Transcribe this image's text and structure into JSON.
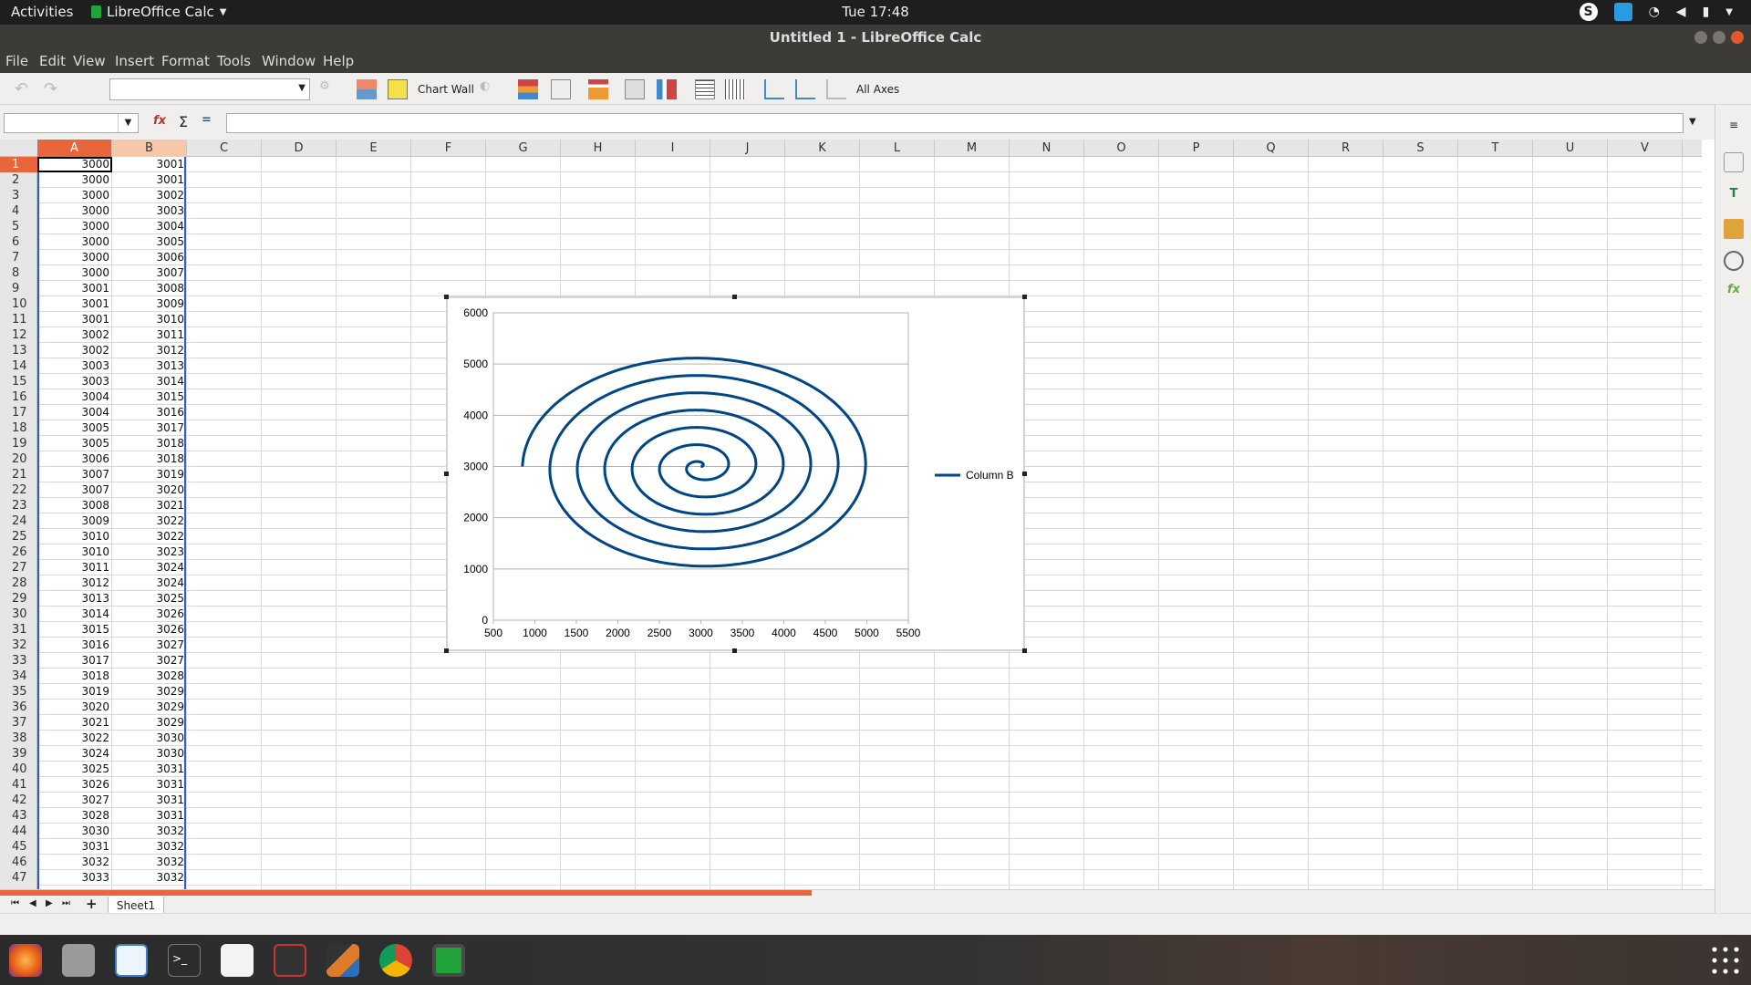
{
  "topbar": {
    "activities": "Activities",
    "app_name": "LibreOffice Calc",
    "clock": "Tue 17:48",
    "skype": "S"
  },
  "window": {
    "title": "Untitled 1 - LibreOffice Calc"
  },
  "menu": [
    "File",
    "Edit",
    "View",
    "Insert",
    "Format",
    "Tools",
    "Window",
    "Help"
  ],
  "toolbar": {
    "chart_wall": "Chart Wall",
    "all_axes": "All Axes"
  },
  "columns": [
    "A",
    "B",
    "C",
    "D",
    "E",
    "F",
    "G",
    "H",
    "I",
    "J",
    "K",
    "L",
    "M",
    "N",
    "O",
    "P",
    "Q",
    "R",
    "S",
    "T",
    "U",
    "V"
  ],
  "rows": [
    1,
    2,
    3,
    4,
    5,
    6,
    7,
    8,
    9,
    10,
    11,
    12,
    13,
    14,
    15,
    16,
    17,
    18,
    19,
    20,
    21,
    22,
    23,
    24,
    25,
    26,
    27,
    28,
    29,
    30,
    31,
    32,
    33,
    34,
    35,
    36,
    37,
    38,
    39,
    40,
    41,
    42,
    43,
    44,
    45,
    46,
    47
  ],
  "cells": {
    "A": [
      3000,
      3000,
      3000,
      3000,
      3000,
      3000,
      3000,
      3000,
      3001,
      3001,
      3001,
      3002,
      3002,
      3003,
      3003,
      3004,
      3004,
      3005,
      3005,
      3006,
      3007,
      3007,
      3008,
      3009,
      3010,
      3010,
      3011,
      3012,
      3013,
      3014,
      3015,
      3016,
      3017,
      3018,
      3019,
      3020,
      3021,
      3022,
      3024,
      3025,
      3026,
      3027,
      3028,
      3030,
      3031,
      3032,
      3033
    ],
    "B": [
      3001,
      3001,
      3002,
      3003,
      3004,
      3005,
      3006,
      3007,
      3008,
      3009,
      3010,
      3011,
      3012,
      3013,
      3014,
      3015,
      3016,
      3017,
      3018,
      3018,
      3019,
      3020,
      3021,
      3022,
      3022,
      3023,
      3024,
      3024,
      3025,
      3026,
      3026,
      3027,
      3027,
      3028,
      3029,
      3029,
      3029,
      3030,
      3030,
      3031,
      3031,
      3031,
      3031,
      3032,
      3032,
      3032,
      3032
    ]
  },
  "sheet": {
    "tab": "Sheet1"
  },
  "chart_data": {
    "type": "line",
    "title": "",
    "xlabel": "",
    "ylabel": "",
    "xlim": [
      500,
      5500
    ],
    "ylim": [
      0,
      6000
    ],
    "x_ticks": [
      "500",
      "1000",
      "1500",
      "2000",
      "2500",
      "3000",
      "3500",
      "4000",
      "4500",
      "5000",
      "5500"
    ],
    "y_ticks": [
      "0",
      "1000",
      "2000",
      "3000",
      "4000",
      "5000",
      "6000"
    ],
    "grid": "horizontal",
    "legend_position": "right",
    "series": [
      {
        "name": "Column B",
        "color": "#004586",
        "shape": "archimedean spiral",
        "center": [
          3000,
          3000
        ],
        "turns": 6.5,
        "outer_radius_x": 2150,
        "outer_radius_y": 2200
      }
    ]
  }
}
